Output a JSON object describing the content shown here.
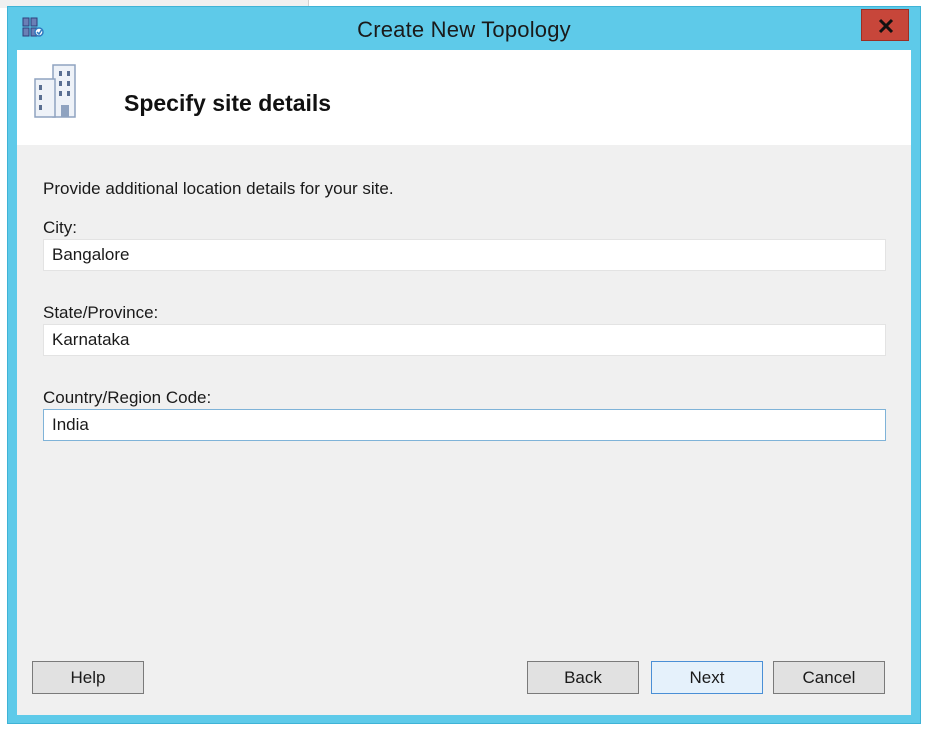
{
  "window": {
    "title": "Create New Topology"
  },
  "header": {
    "title": "Specify site details"
  },
  "content": {
    "instructions": "Provide additional location details for your site.",
    "fields": [
      {
        "label": "City:",
        "value": "Bangalore"
      },
      {
        "label": "State/Province:",
        "value": "Karnataka"
      },
      {
        "label": "Country/Region Code:",
        "value": "India"
      }
    ]
  },
  "buttons": {
    "help": "Help",
    "back": "Back",
    "next": "Next",
    "cancel": "Cancel"
  },
  "icons": {
    "app": "topology-app-icon",
    "header": "building-icon",
    "close": "close-icon"
  },
  "colors": {
    "titlebar": "#5ecae9",
    "close_button": "#c7463a",
    "content_bg": "#f0f0f0",
    "default_button_border": "#4a8fd6"
  }
}
